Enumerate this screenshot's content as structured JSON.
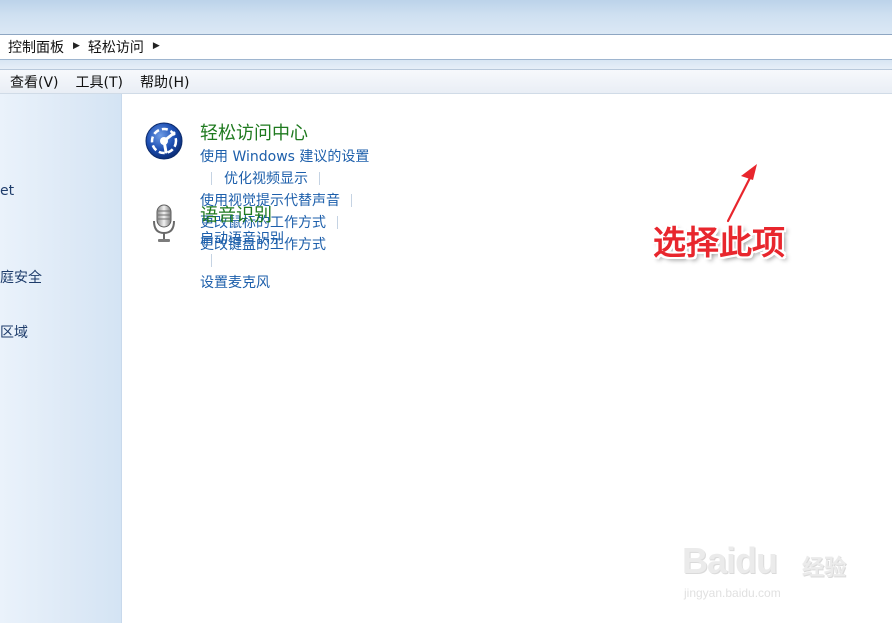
{
  "breadcrumb": {
    "items": [
      "控制面板",
      "轻松访问"
    ]
  },
  "menu": {
    "items": [
      "查看(V)",
      "工具(T)",
      "帮助(H)"
    ]
  },
  "sidebar": {
    "items": [
      "et",
      "庭安全",
      "区域"
    ]
  },
  "sections": [
    {
      "title": "轻松访问中心",
      "links": [
        "使用 Windows 建议的设置",
        "优化视频显示",
        "使用视觉提示代替声音",
        "更改鼠标的工作方式",
        "更改键盘的工作方式"
      ]
    },
    {
      "title": "语音识别",
      "links": [
        "启动语音识别",
        "设置麦克风"
      ]
    }
  ],
  "annotation": {
    "text": "选择此项",
    "color": "#e8262d"
  },
  "watermark": {
    "brand": "Baidu",
    "suffix": "经验",
    "url": "jingyan.baidu.com"
  },
  "colors": {
    "link": "#1d5fab",
    "heading": "#1f7a1f"
  }
}
